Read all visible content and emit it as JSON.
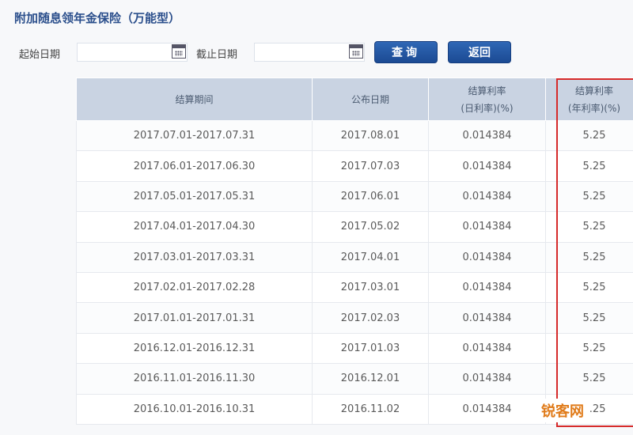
{
  "page": {
    "title": "附加随息领年金保险（万能型）"
  },
  "search": {
    "start_label": "起始日期",
    "end_label": "截止日期",
    "start_value": "",
    "end_value": "",
    "query_label": "查询",
    "back_label": "返回"
  },
  "table": {
    "headers": [
      {
        "line1": "结算期间",
        "line2": ""
      },
      {
        "line1": "公布日期",
        "line2": ""
      },
      {
        "line1": "结算利率",
        "line2": "(日利率)(%)"
      },
      {
        "line1": "结算利率",
        "line2": "(年利率)(%)"
      }
    ],
    "rows": [
      [
        "2017.07.01-2017.07.31",
        "2017.08.01",
        "0.014384",
        "5.25"
      ],
      [
        "2017.06.01-2017.06.30",
        "2017.07.03",
        "0.014384",
        "5.25"
      ],
      [
        "2017.05.01-2017.05.31",
        "2017.06.01",
        "0.014384",
        "5.25"
      ],
      [
        "2017.04.01-2017.04.30",
        "2017.05.02",
        "0.014384",
        "5.25"
      ],
      [
        "2017.03.01-2017.03.31",
        "2017.04.01",
        "0.014384",
        "5.25"
      ],
      [
        "2017.02.01-2017.02.28",
        "2017.03.01",
        "0.014384",
        "5.25"
      ],
      [
        "2017.01.01-2017.01.31",
        "2017.02.03",
        "0.014384",
        "5.25"
      ],
      [
        "2016.12.01-2016.12.31",
        "2017.01.03",
        "0.014384",
        "5.25"
      ],
      [
        "2016.11.01-2016.11.30",
        "2016.12.01",
        "0.014384",
        "5.25"
      ],
      [
        "2016.10.01-2016.10.31",
        "2016.11.02",
        "0.014384",
        "5.25"
      ]
    ]
  },
  "watermark": {
    "text": "锐客网"
  },
  "colors": {
    "accent": "#1b4a93",
    "header_bg": "#c9d3e2",
    "highlight": "#d62a2a",
    "watermark": "#e07b1a"
  }
}
